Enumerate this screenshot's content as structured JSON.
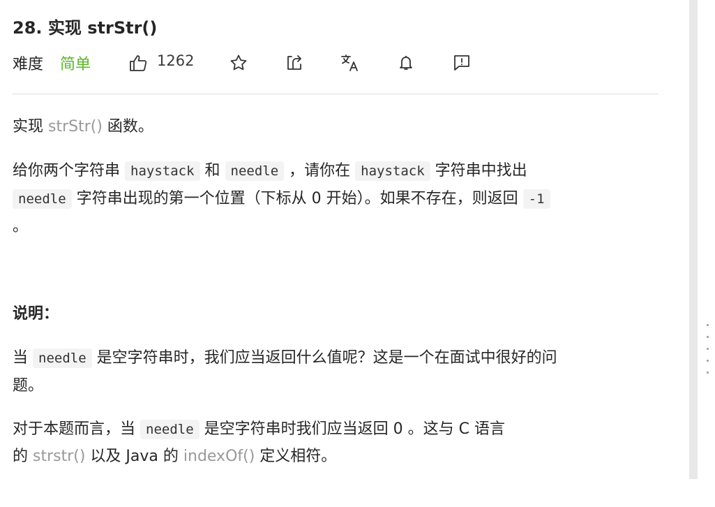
{
  "problem": {
    "title": "28. 实现 strStr()",
    "difficulty_label": "难度",
    "difficulty_value": "简单",
    "likes": "1262"
  },
  "toolbar_icons": [
    "thumbs-up-icon",
    "star-icon",
    "share-icon",
    "translate-icon",
    "bell-icon",
    "feedback-icon"
  ],
  "colors": {
    "difficulty_easy": "#5ab726",
    "function_gray": "#999999",
    "code_bg": "#f3f3f3"
  },
  "description": {
    "p1": {
      "a": "实现 ",
      "fn": "strStr()",
      "b": " 函数。"
    },
    "p2": {
      "a": "给你两个字符串 ",
      "code1": "haystack",
      "b": " 和 ",
      "code2": "needle",
      "c": " ，请你在 ",
      "code3": "haystack",
      "d": " 字符串中找出",
      "code4": "needle",
      "e": " 字符串出现的第一个位置（下标从 0 开始）。如果不存在，则返回 ",
      "code5": "-1",
      "f": "。"
    },
    "note_heading": "说明：",
    "p3": {
      "a": "当 ",
      "code1": "needle",
      "b": " 是空字符串时，我们应当返回什么值呢？这是一个在面试中很好的问",
      "c": "题。"
    },
    "p4": {
      "a": "对于本题而言，当 ",
      "code1": "needle",
      "b": " 是空字符串时我们应当返回 0 。这与 C 语言",
      "c": "的 ",
      "fn1": "strstr()",
      "d": " 以及 Java 的 ",
      "fn2": "indexOf()",
      "e": " 定义相符。"
    }
  }
}
